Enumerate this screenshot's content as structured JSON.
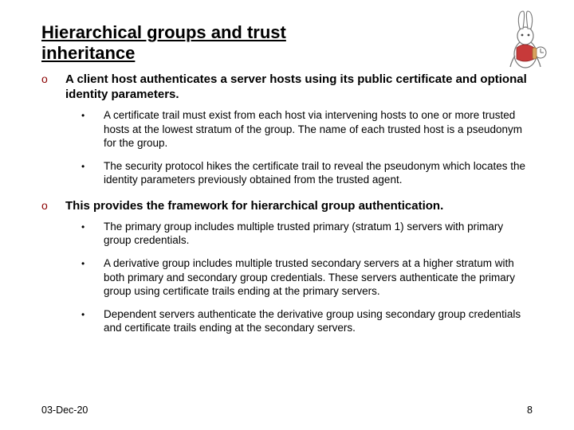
{
  "title": "Hierarchical groups and trust inheritance",
  "items": [
    {
      "text": "A client host authenticates a server hosts using its public certificate and optional identity parameters.",
      "sub": [
        "A certificate trail must exist from each host via intervening hosts to one or more trusted hosts at the lowest stratum of the group. The name of each trusted host is a pseudonym for the group.",
        "The security protocol hikes the certificate trail to reveal the pseudonym which locates the identity parameters previously obtained from the trusted agent."
      ]
    },
    {
      "text": "This provides the framework for hierarchical group authentication.",
      "sub": [
        "The primary group includes multiple trusted primary (stratum 1) servers with primary group credentials.",
        "A derivative group includes multiple trusted secondary servers at a higher stratum with both primary and secondary group credentials. These servers authenticate the primary group using certificate trails ending at the primary servers.",
        "Dependent servers authenticate the derivative group using secondary group credentials and certificate trails ending at the secondary servers."
      ]
    }
  ],
  "footer": {
    "date": "03-Dec-20",
    "page": "8"
  }
}
